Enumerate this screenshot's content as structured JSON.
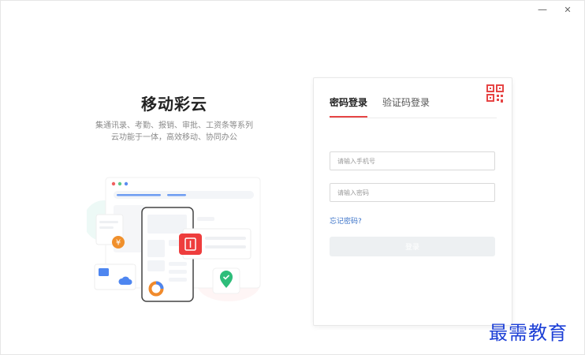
{
  "window": {
    "minimize_glyph": "—",
    "close_glyph": "✕"
  },
  "intro": {
    "title": "移动彩云",
    "desc_line1": "集通讯录、考勤、报销、审批、工资条等系列",
    "desc_line2": "云功能于一体，高效移动、协同办公",
    "badge_currency": "¥"
  },
  "login": {
    "tabs": [
      {
        "label": "密码登录",
        "active": true
      },
      {
        "label": "验证码登录",
        "active": false
      }
    ],
    "phone_placeholder": "请输入手机号",
    "password_placeholder": "请输入密码",
    "forgot_label": "忘记密码?",
    "submit_label": "登录"
  },
  "watermark": "最需教育",
  "colors": {
    "accent": "#e64545",
    "link": "#3a72c8",
    "disabled_button": "#edf0f2"
  }
}
